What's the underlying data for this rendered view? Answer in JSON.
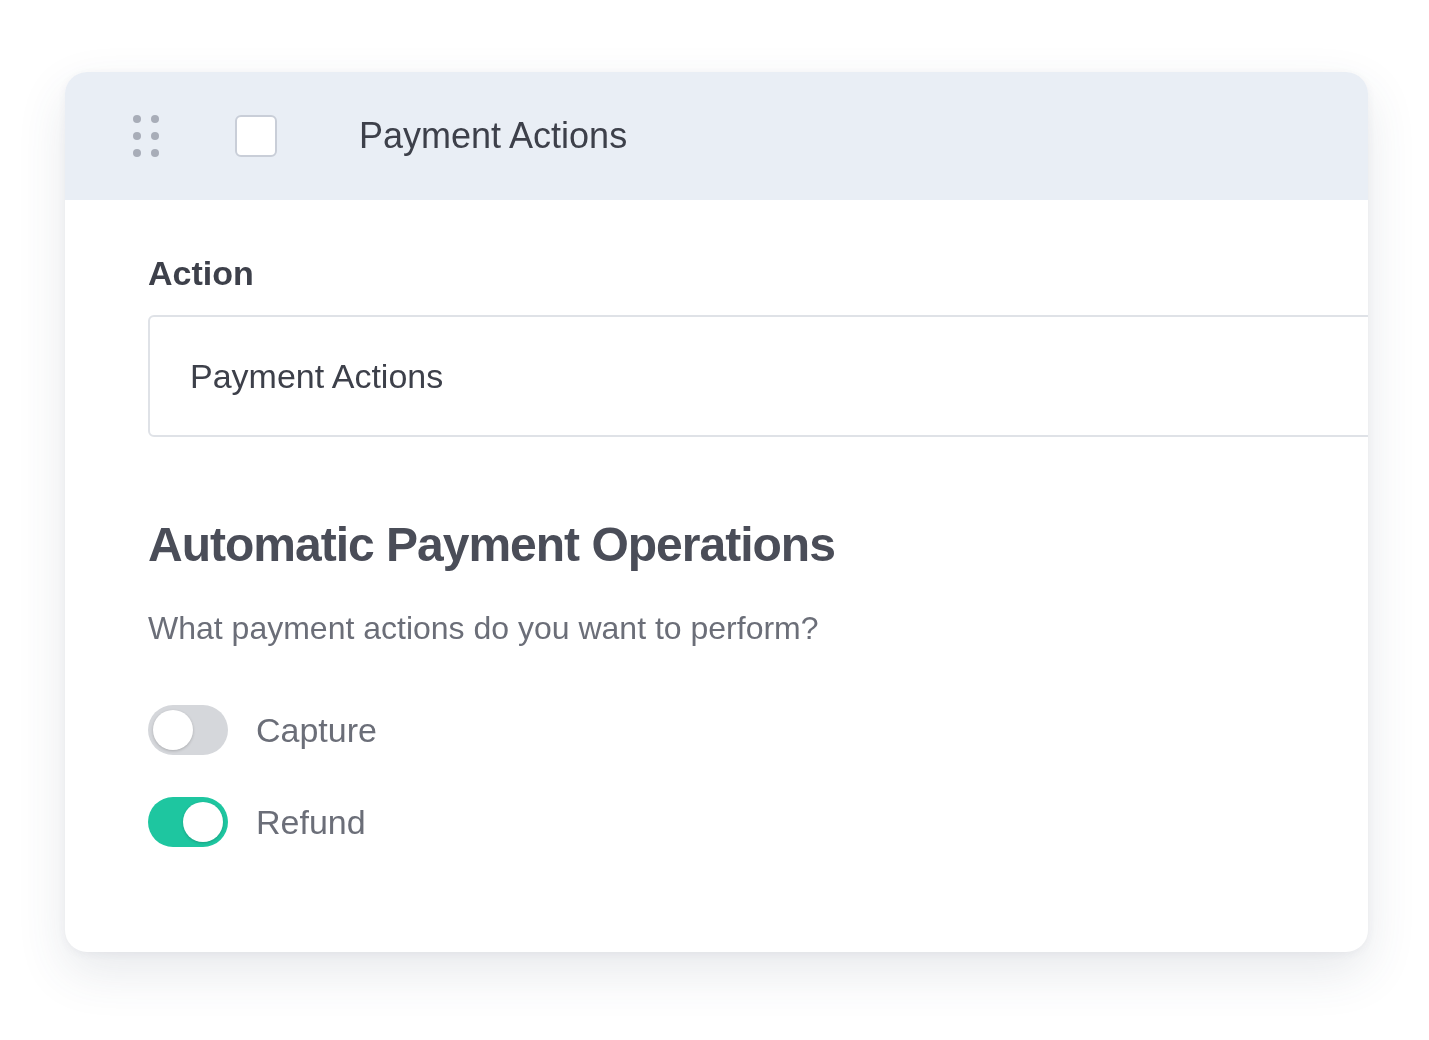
{
  "header": {
    "title": "Payment Actions",
    "checked": false
  },
  "action": {
    "label": "Action",
    "value": "Payment Actions"
  },
  "section": {
    "heading": "Automatic Payment Operations",
    "description": "What payment actions do you want to perform?"
  },
  "toggles": [
    {
      "label": "Capture",
      "on": false
    },
    {
      "label": "Refund",
      "on": true
    }
  ]
}
